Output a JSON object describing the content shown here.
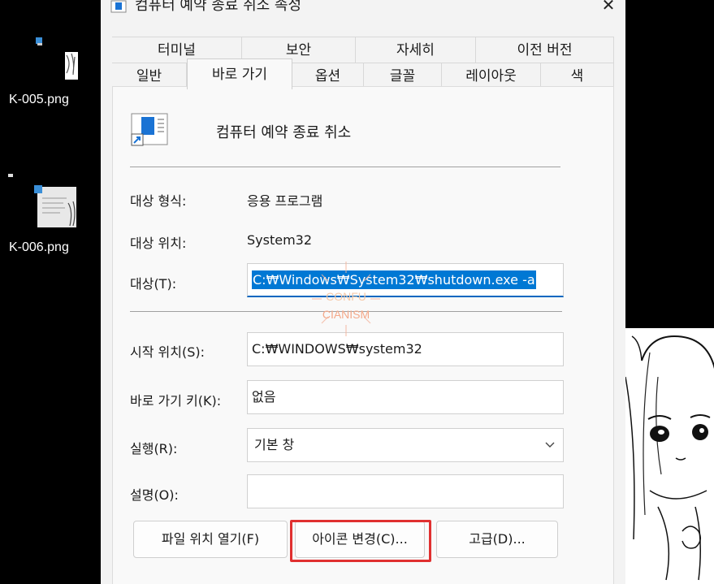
{
  "desktop": {
    "icons": [
      {
        "label": "K-005.png"
      },
      {
        "label": "K-006.png"
      }
    ]
  },
  "dialog": {
    "title": "컴퓨터 예약 종료 취소 속성",
    "close_glyph": "✕",
    "tabs_row1": [
      "터미널",
      "보안",
      "자세히",
      "이전 버전"
    ],
    "tabs_row2": [
      "일반",
      "바로 가기",
      "옵션",
      "글꼴",
      "레이아웃",
      "색"
    ],
    "active_tab": "바로 가기",
    "app_name": "컴퓨터 예약 종료 취소",
    "target_type": {
      "label": "대상 형식:",
      "value": "응용 프로그램"
    },
    "target_location": {
      "label": "대상 위치:",
      "value": "System32"
    },
    "target": {
      "label": "대상(T):",
      "value": "C:₩Windows₩System32₩shutdown.exe -a"
    },
    "start_in": {
      "label": "시작 위치(S):",
      "value": "C:₩WINDOWS₩system32"
    },
    "shortcut_key": {
      "label": "바로 가기 키(K):",
      "value": "없음"
    },
    "run": {
      "label": "실행(R):",
      "value": "기본 창"
    },
    "comment": {
      "label": "설명(O):",
      "value": ""
    },
    "buttons": {
      "open_location": "파일 위치 열기(F)",
      "change_icon": "아이콘 변경(C)...",
      "advanced": "고급(D)..."
    }
  },
  "watermark": {
    "line1": "CONFU",
    "line2": "CIANISM"
  },
  "colors": {
    "accent": "#0078d4",
    "highlight": "#e03030",
    "dialog_bg": "#f3f3f3"
  }
}
